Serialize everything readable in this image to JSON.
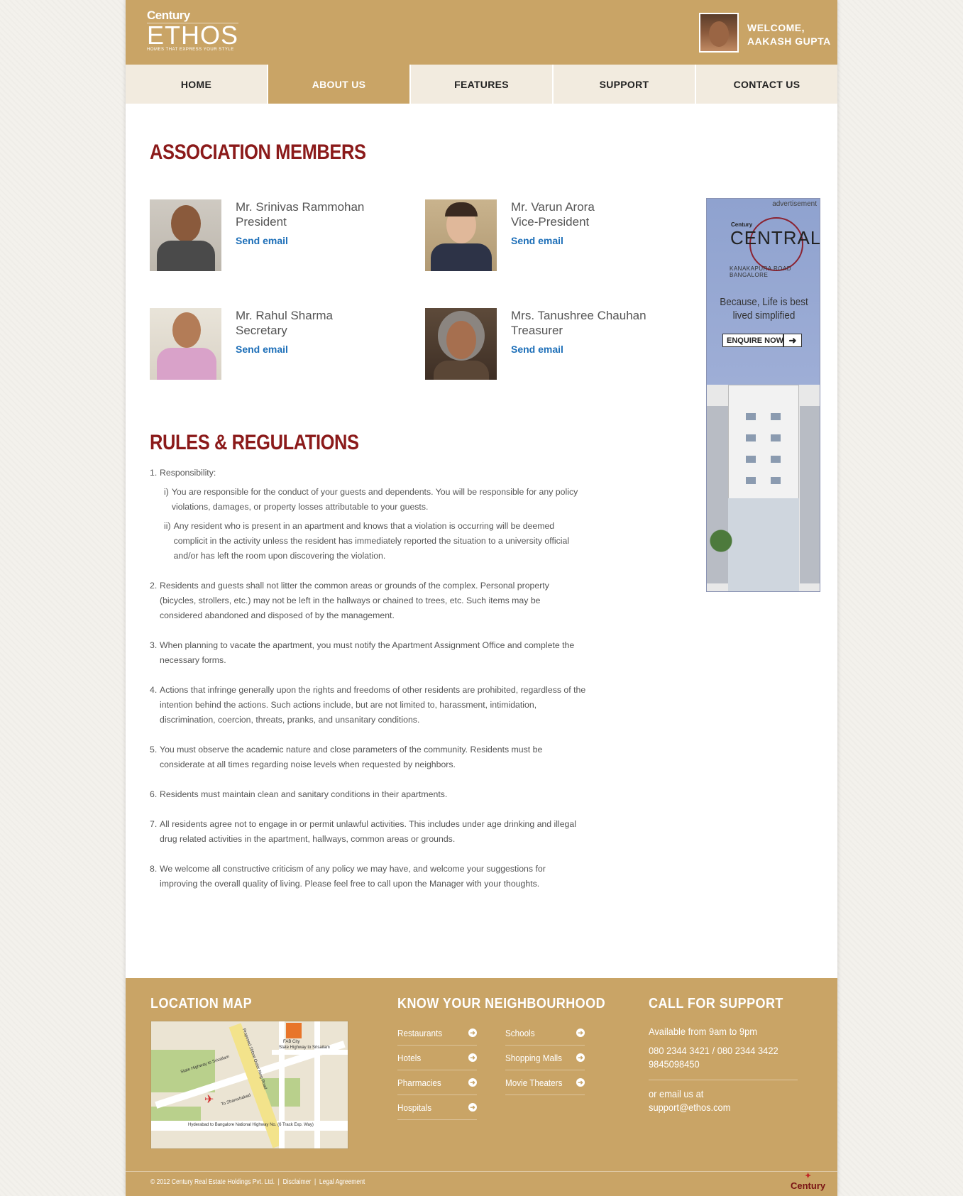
{
  "header": {
    "logo_small": "Century",
    "logo_big": "ETHOS",
    "logo_tagline": "HOMES THAT EXPRESS YOUR STYLE",
    "welcome_line1": "WELCOME,",
    "welcome_line2": "AAKASH GUPTA"
  },
  "nav": {
    "items": [
      {
        "label": "HOME"
      },
      {
        "label": "ABOUT US"
      },
      {
        "label": "FEATURES"
      },
      {
        "label": "SUPPORT"
      },
      {
        "label": "CONTACT US"
      }
    ],
    "active": "ABOUT US"
  },
  "association": {
    "title": "ASSOCIATION MEMBERS",
    "members": [
      {
        "name": "Mr. Srinivas Rammohan",
        "role": "President",
        "link": "Send email"
      },
      {
        "name": "Mr. Varun Arora",
        "role": "Vice-President",
        "link": "Send email"
      },
      {
        "name": "Mr. Rahul Sharma",
        "role": "Secretary",
        "link": "Send email"
      },
      {
        "name": "Mrs. Tanushree Chauhan",
        "role": "Treasurer",
        "link": "Send email"
      }
    ]
  },
  "rules": {
    "title": "RULES & REGULATIONS",
    "items": [
      {
        "num": "1.",
        "text": "Responsibility:",
        "subs": [
          {
            "num": "i)",
            "text": "You are responsible for the conduct of your guests and dependents. You will be responsible for any policy violations, damages, or property losses attributable to your guests."
          },
          {
            "num": "ii)",
            "text": "Any resident who is present in an apartment and knows that a violation is occurring will be deemed complicit in the activity unless the resident has immediately reported the situation to a university official and/or has left the room upon discovering the violation."
          }
        ]
      },
      {
        "num": "2.",
        "text": "Residents and guests shall not litter the common areas or grounds of the complex.  Personal property (bicycles, strollers, etc.) may not be left in the hallways or chained to trees, etc.  Such items may be considered abandoned and disposed of by the management."
      },
      {
        "num": "3.",
        "text": "When planning to vacate the apartment, you must notify the Apartment Assignment Office and complete the necessary forms."
      },
      {
        "num": "4.",
        "text": "Actions that infringe generally upon the rights and freedoms of other residents are prohibited, regardless of the intention behind the actions. Such actions include, but are not limited to, harassment, intimidation, discrimination, coercion, threats, pranks, and unsanitary conditions."
      },
      {
        "num": "5.",
        "text": "You must observe the academic nature and close parameters of the community. Residents must be considerate at all times regarding noise levels when requested by neighbors."
      },
      {
        "num": "6.",
        "text": "Residents must maintain clean and sanitary conditions in their apartments."
      },
      {
        "num": "7.",
        "text": "All residents agree not to engage in or permit unlawful activities.  This includes under age drinking and illegal drug related activities in the apartment, hallways, common areas or grounds."
      },
      {
        "num": "8.",
        "text": "We welcome all constructive criticism of any policy we may have, and welcome your suggestions for improving the overall quality of living.  Please feel free to call upon the Manager with your thoughts."
      }
    ]
  },
  "ad": {
    "label": "advertisement",
    "brand": "Century",
    "title": "CENTRAL",
    "location_line1": "KANAKAPURA ROAD",
    "location_line2": "BANGALORE",
    "slogan": "Because, Life is best lived simplified",
    "button": "ENQUIRE NOW"
  },
  "footer": {
    "map_title": "LOCATION MAP",
    "map_labels": {
      "highway": "State Highway to Srisailam",
      "highway2": "State Highway to Srisailam",
      "ring_road": "Proposed 150mt Outer Ring Road",
      "national_highway": "Hyderabad to Bangalore National Highway No. (6 Track Exp. Way)",
      "fab_city": "FAB City",
      "shamshabad": "To Shamshabad"
    },
    "neighbourhood_title": "KNOW YOUR NEIGHBOURHOOD",
    "neighbourhood_col1": [
      "Restaurants",
      "Hotels",
      "Pharmacies",
      "Hospitals"
    ],
    "neighbourhood_col2": [
      "Schools",
      "Shopping Malls",
      "Movie Theaters"
    ],
    "support_title": "CALL FOR SUPPORT",
    "support_hours": "Available from 9am to 9pm",
    "support_phone1": "080 2344 3421 / 080 2344 3422",
    "support_phone2": "9845098450",
    "support_email": "or email us at support@ethos.com",
    "copyright": "© 2012 Century Real Estate Holdings Pvt. Ltd.",
    "disclaimer": "Disclaimer",
    "legal": "Legal Agreement",
    "footer_brand": "Century"
  },
  "colors": {
    "gold": "#c9a466",
    "heading_red": "#8b1a1a",
    "link_blue": "#1d6fb8"
  }
}
